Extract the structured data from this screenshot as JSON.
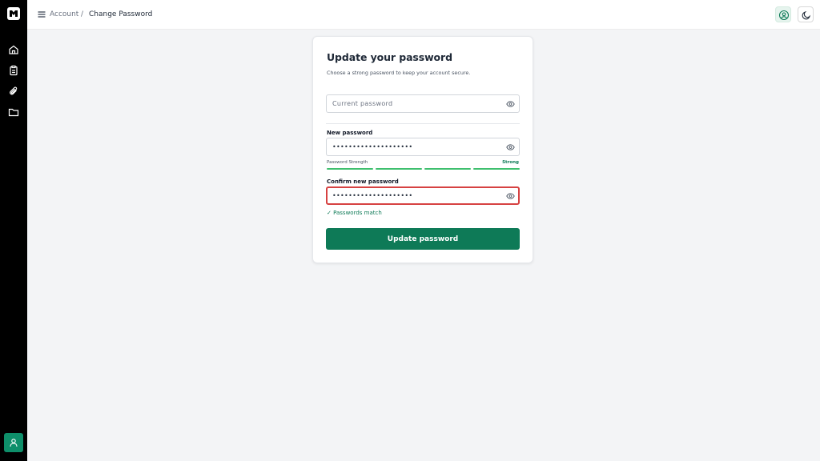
{
  "sidebar": {
    "logo": "brand-logo-icon",
    "icons": [
      "home-icon",
      "clipboard-icon",
      "paperclip-icon",
      "folder-icon"
    ],
    "user_button": "user-icon",
    "accent": "#0e8f6a"
  },
  "header": {
    "menu_icon": "hamburger-icon",
    "breadcrumb": {
      "parent": "Account",
      "separator": "/",
      "current": "Change Password"
    },
    "profile_icon": "user-circle-icon",
    "theme_icon": "moon-icon"
  },
  "form": {
    "title": "Update your password",
    "subtitle": "Choose a strong password to keep your account secure.",
    "current": {
      "placeholder": "Current password",
      "value": ""
    },
    "new": {
      "label": "New password",
      "value": "••••••••••••••••••••"
    },
    "strength": {
      "label": "Password Strength",
      "value": "Strong",
      "level": 4,
      "max": 4
    },
    "confirm": {
      "label": "Confirm new password",
      "value": "••••••••••••••••••••"
    },
    "match_text": "✓ Passwords match",
    "submit_label": "Update password",
    "colors": {
      "primary": "#0e7a57",
      "error_border": "#d64242",
      "strength_bar": "#3fbf6e"
    }
  }
}
